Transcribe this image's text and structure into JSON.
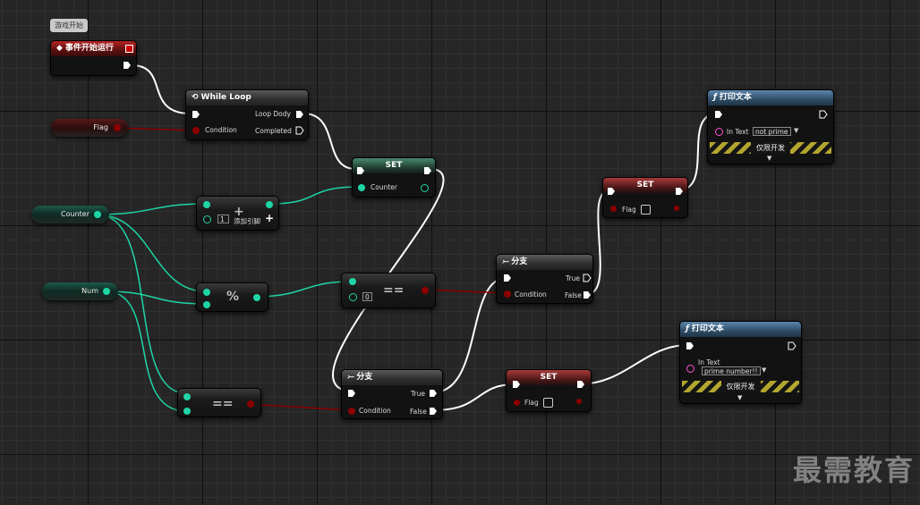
{
  "comment_bubble": "游戏开始",
  "event_node": {
    "title": "事件开始运行"
  },
  "while_loop": {
    "title": "While Loop",
    "loop_body": "Loop Dody",
    "condition": "Condition",
    "completed": "Completed"
  },
  "flag_var": {
    "label": "Flag"
  },
  "counter_var": {
    "label": "Counter"
  },
  "num_var": {
    "label": "Num"
  },
  "set_counter": {
    "title": "SET",
    "pin": "Counter"
  },
  "add_node": {
    "symbol": "+",
    "value": "1",
    "add_pin": "添加引脚"
  },
  "mod_node": {
    "symbol": "%"
  },
  "eq_zero": {
    "symbol": "==",
    "value": "0"
  },
  "branch1": {
    "title": "分支",
    "true": "True",
    "condition": "Condition",
    "false": "False"
  },
  "set_flag_top": {
    "title": "SET",
    "pin": "Flag"
  },
  "print_top": {
    "title": "打印文本",
    "in_text": "In Text",
    "value": "not prime",
    "dev": "仅限开发"
  },
  "eq_num": {
    "symbol": "=="
  },
  "branch2": {
    "title": "分支",
    "true": "True",
    "condition": "Condition",
    "false": "False"
  },
  "set_flag_bottom": {
    "title": "SET",
    "pin": "Flag"
  },
  "print_bottom": {
    "title": "打印文本",
    "in_text": "In Text",
    "value": "prime number!!",
    "dev": "仅限开发"
  },
  "watermark": "最需教育",
  "colors": {
    "exec": "#ffffff",
    "bool": "#8c0000",
    "int": "#1ed5a5",
    "string": "#ff4fd5"
  }
}
